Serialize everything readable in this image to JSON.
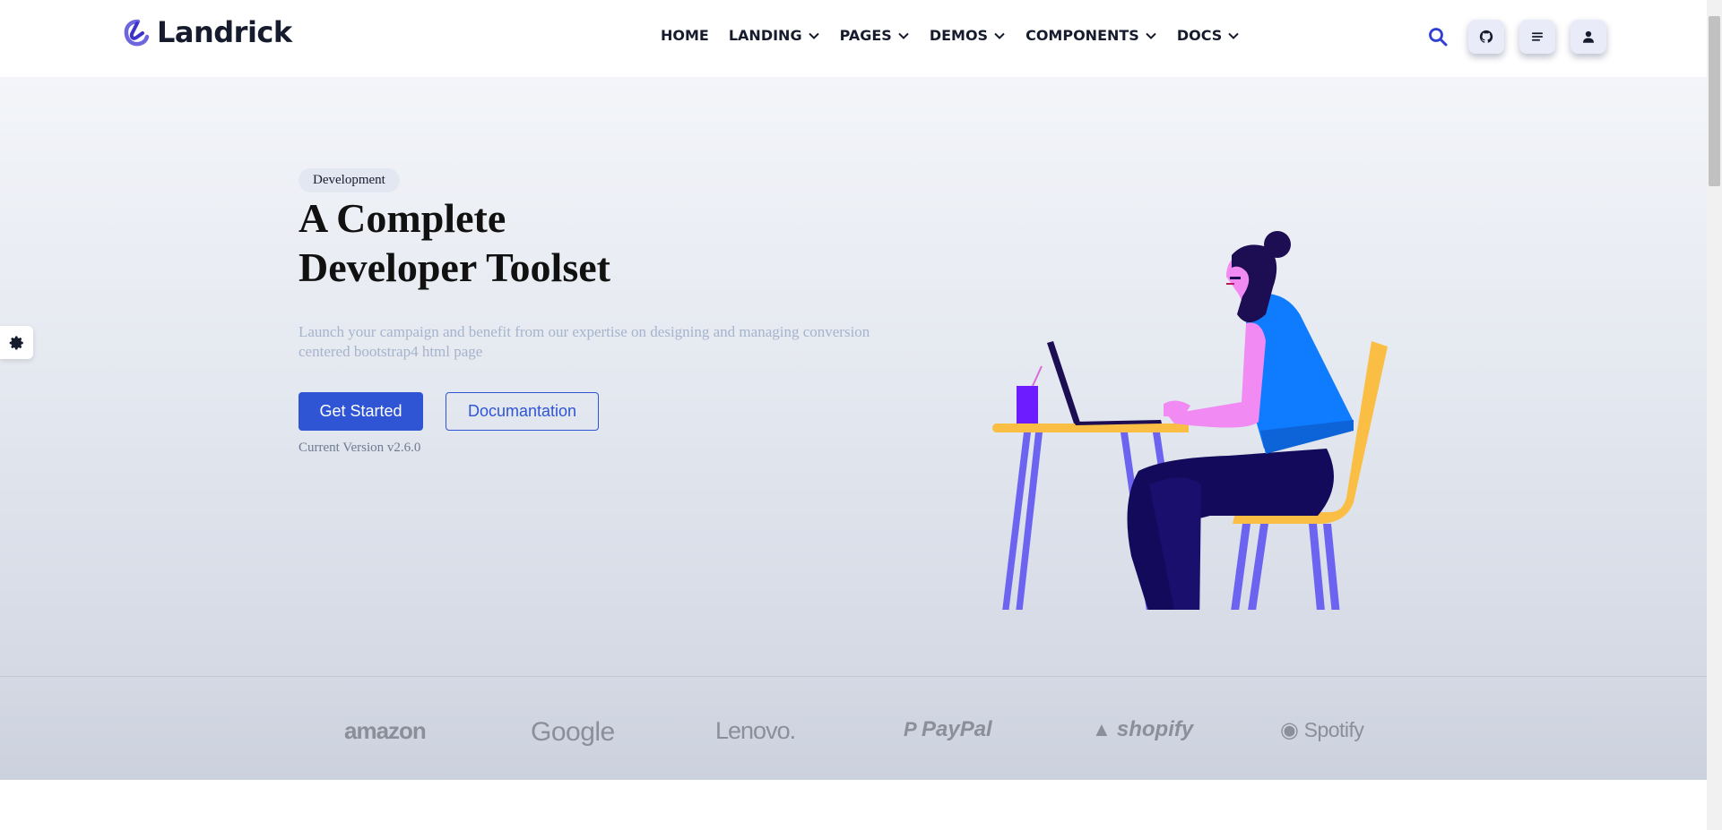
{
  "brand": {
    "name": "Landrick",
    "accent": "#2f55d4",
    "logo_color": "#6e66dd"
  },
  "nav": {
    "items": [
      {
        "label": "HOME",
        "dropdown": false
      },
      {
        "label": "LANDING",
        "dropdown": true
      },
      {
        "label": "PAGES",
        "dropdown": true
      },
      {
        "label": "DEMOS",
        "dropdown": true
      },
      {
        "label": "COMPONENTS",
        "dropdown": true
      },
      {
        "label": "DOCS",
        "dropdown": true
      }
    ],
    "icons": [
      "search-icon",
      "github-icon",
      "menu-lines-icon",
      "user-icon"
    ]
  },
  "hero": {
    "badge": "Development",
    "title_line1": "A Complete",
    "title_line2": "Developer Toolset",
    "subtitle": "Launch your campaign and benefit from our expertise on designing and managing conversion centered bootstrap4 html page",
    "primary_button": "Get Started",
    "secondary_button": "Documantation",
    "version": "Current Version v2.6.0"
  },
  "switcher": {
    "icon": "gear-icon"
  },
  "partners": {
    "logos": [
      "amazon",
      "Google",
      "Lenovo.",
      "PayPal",
      "shopify",
      "Spotify"
    ]
  }
}
